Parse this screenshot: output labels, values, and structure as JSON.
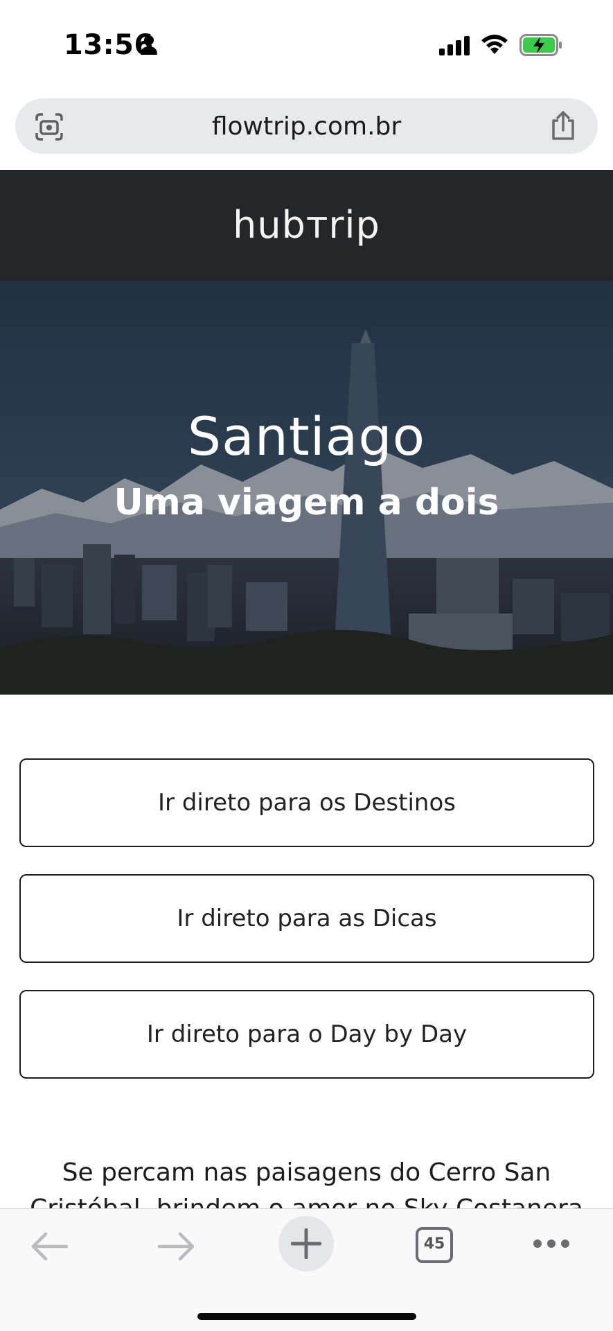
{
  "status_bar": {
    "time": "13:56"
  },
  "browser": {
    "url": "flowtrip.com.br",
    "tab_count": "45"
  },
  "site": {
    "logo": "hubтrip"
  },
  "hero": {
    "title": "Santiago",
    "subtitle": "Uma viagem a dois"
  },
  "buttons": [
    {
      "label": "Ir direto para os Destinos"
    },
    {
      "label": "Ir direto para as Dicas"
    },
    {
      "label": "Ir direto para o Day by Day"
    }
  ],
  "intro_text": "Se percam nas paisagens do Cerro San Cristóbal, brindem o amor no Sky Costanera",
  "colors": {
    "header_bg": "#252628",
    "battery_green": "#3ccb4a",
    "url_bar_bg": "#e8e9ec"
  }
}
